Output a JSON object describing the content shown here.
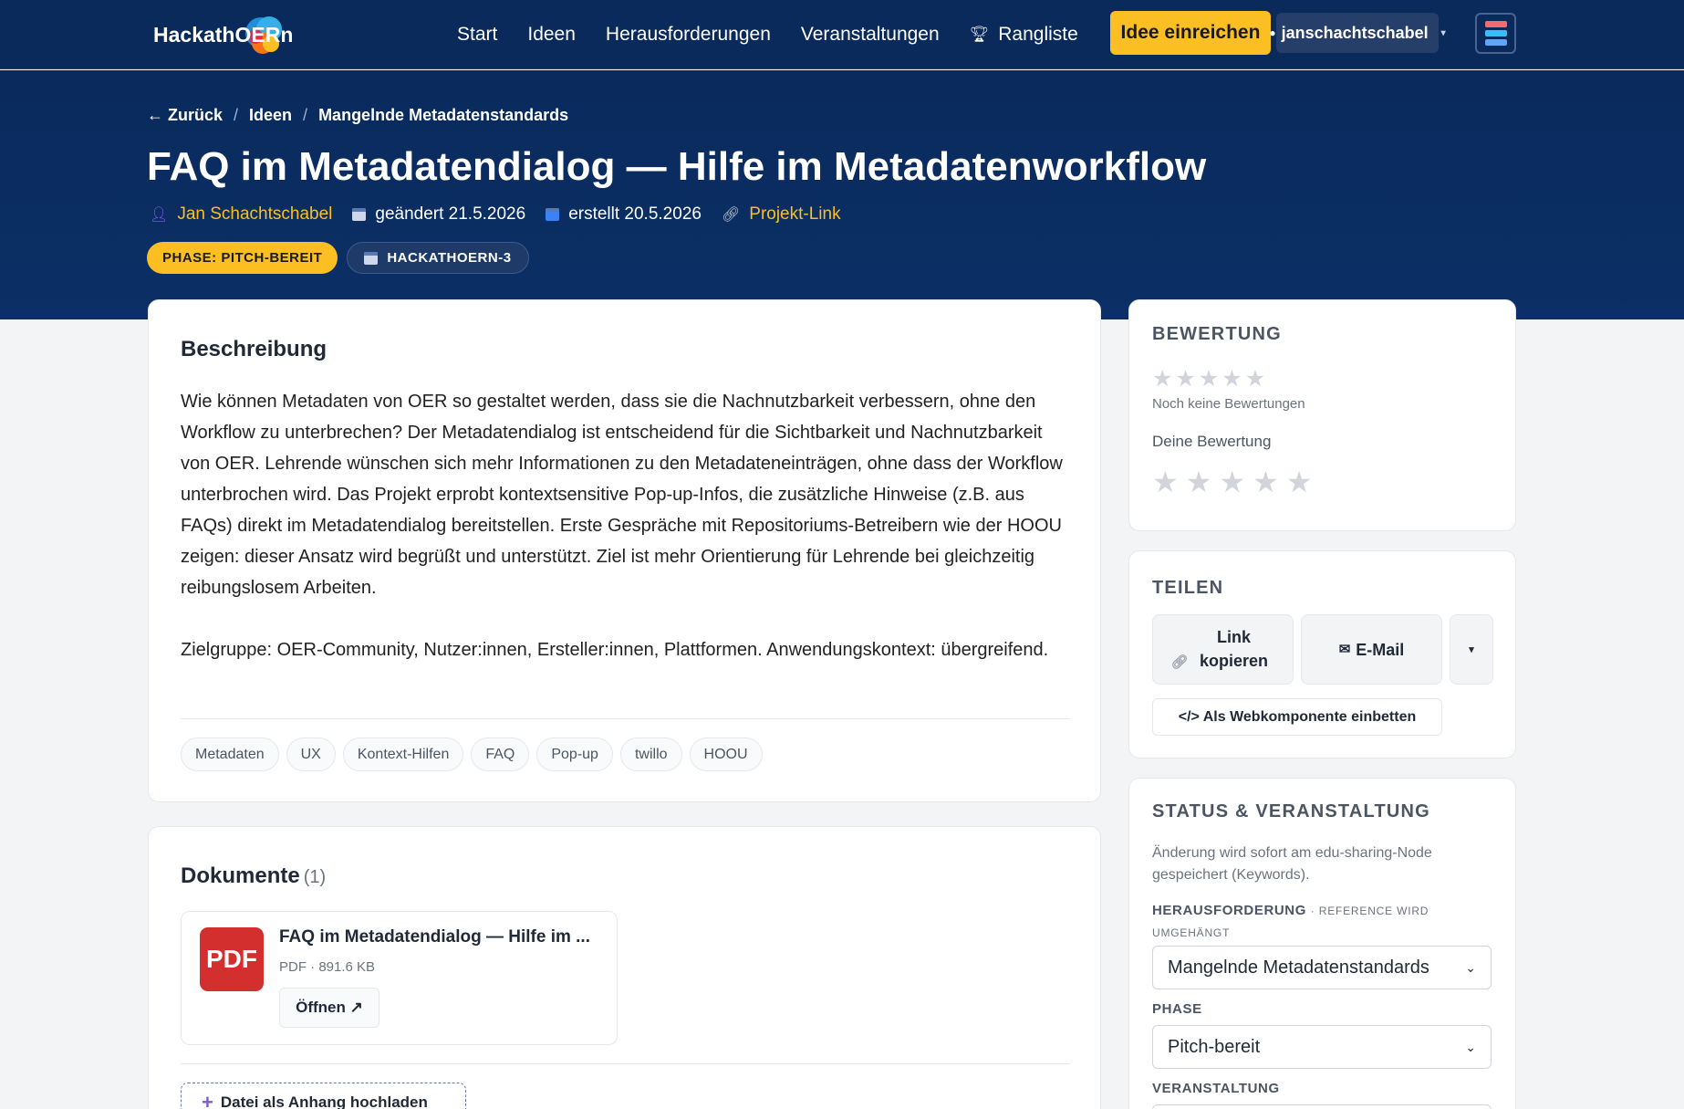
{
  "nav": {
    "logo_text": "HackathOERn",
    "links": [
      "Start",
      "Ideen",
      "Herausforderungen",
      "Veranstaltungen",
      "Rangliste"
    ],
    "submit_label": "Idee einreichen",
    "username": "janschachtschabel"
  },
  "breadcrumb": {
    "back": "← Zurück",
    "ideas": "Ideen",
    "current": "Mangelnde Metadatenstandards"
  },
  "idea": {
    "title": "FAQ im Metadatendialog — Hilfe im Metadatenworkflow",
    "author": "Jan Schachtschabel",
    "changed": "geändert 21.5.2026",
    "created": "erstellt 20.5.2026",
    "project_link": "Projekt-Link",
    "phase_badge": "PHASE: PITCH-BEREIT",
    "event_badge": "HACKATHOERN-3"
  },
  "description": {
    "heading": "Beschreibung",
    "paragraph1": "Wie können Metadaten von OER so gestaltet werden, dass sie die Nachnutzbarkeit verbessern, ohne den Workflow zu unterbrechen? Der Metadatendialog ist entscheidend für die Sichtbarkeit und Nachnutzbarkeit von OER. Lehrende wünschen sich mehr Informationen zu den Metadateneinträgen, ohne dass der Workflow unterbrochen wird. Das Projekt erprobt kontextsensitive Pop-up-Infos, die zusätzliche Hinweise (z.B. aus FAQs) direkt im Metadatendialog bereitstellen. Erste Gespräche mit Repositoriums-Betreibern wie der HOOU zeigen: dieser Ansatz wird begrüßt und unterstützt. Ziel ist mehr Orientierung für Lehrende bei gleichzeitig reibungslosem Arbeiten.",
    "paragraph2": "Zielgruppe: OER-Community, Nutzer:innen, Ersteller:innen, Plattformen. Anwendungskontext: übergreifend.",
    "tags": [
      "Metadaten",
      "UX",
      "Kontext-Hilfen",
      "FAQ",
      "Pop-up",
      "twillo",
      "HOOU"
    ]
  },
  "documents": {
    "heading": "Dokumente",
    "count": "(1)",
    "item": {
      "icon_text": "PDF",
      "title": "FAQ im Metadatendialog — Hilfe im ...",
      "meta": "PDF · 891.6 KB",
      "open_label": "Öffnen ↗"
    },
    "upload_label": "Datei als Anhang hochladen"
  },
  "rating": {
    "heading": "BEWERTUNG",
    "no_ratings": "Noch keine Bewertungen",
    "your_rating": "Deine Bewertung",
    "average_stars": 0,
    "max_stars": 5
  },
  "share": {
    "heading": "TEILEN",
    "copy_link": "Link kopieren",
    "email": "E-Mail",
    "more": "▾",
    "embed": "</> Als Webkomponente einbetten"
  },
  "status": {
    "heading": "STATUS & VERANSTALTUNG",
    "note": "Änderung wird sofort am edu-sharing-Node gespeichert (Keywords).",
    "challenge_label": "HERAUSFORDERUNG",
    "challenge_sub": "· REFERENCE WIRD UMGEHÄNGT",
    "challenge_value": "Mangelnde Metadatenstandards",
    "phase_label": "PHASE",
    "phase_value": "Pitch-bereit",
    "event_label": "VERANSTALTUNG"
  },
  "colors": {
    "nav_bg": "#0a2a5c",
    "accent_yellow": "#fbbf24",
    "pdf_red": "#d32f2f"
  }
}
